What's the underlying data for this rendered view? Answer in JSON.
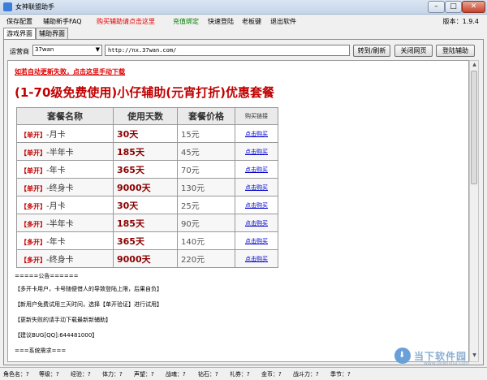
{
  "window": {
    "title": "女神联盟助手"
  },
  "menu": {
    "items": [
      {
        "label": "保存配置"
      },
      {
        "label": "辅助新手FAQ"
      },
      {
        "label": "购买辅助请点击这里"
      },
      {
        "label": "充值绑定"
      },
      {
        "label": "快速登陆"
      },
      {
        "label": "老板键"
      },
      {
        "label": "退出软件"
      }
    ],
    "version": "版本：1.9.4"
  },
  "tabs": [
    {
      "label": "游戏界面"
    },
    {
      "label": "辅助界面"
    }
  ],
  "toolbar": {
    "operator_label": "运营商",
    "operator_value": "37wan",
    "url": "http://nx.37wan.com/",
    "go_label": "转到/刷新",
    "close_label": "关闭网页",
    "login_label": "登陆辅助"
  },
  "content": {
    "notice_link": "如若自动更新失败，点击这里手动下载",
    "heading": "(1-70级免费使用)小仔辅助(元宵打折)优惠套餐",
    "table": {
      "headers": [
        "套餐名称",
        "使用天数",
        "套餐价格",
        "购买链接"
      ],
      "rows": [
        {
          "tag": "【单开】",
          "name": "-月卡",
          "days": "30天",
          "price": "15元",
          "link": "点击购买"
        },
        {
          "tag": "【单开】",
          "name": "-半年卡",
          "days": "185天",
          "price": "45元",
          "link": "点击购买"
        },
        {
          "tag": "【单开】",
          "name": "-年卡",
          "days": "365天",
          "price": "70元",
          "link": "点击购买"
        },
        {
          "tag": "【单开】",
          "name": "-终身卡",
          "days": "9000天",
          "price": "130元",
          "link": "点击购买"
        },
        {
          "tag": "【多开】",
          "name": "-月卡",
          "days": "30天",
          "price": "25元",
          "link": "点击购买"
        },
        {
          "tag": "【多开】",
          "name": "-半年卡",
          "days": "185天",
          "price": "90元",
          "link": "点击购买"
        },
        {
          "tag": "【多开】",
          "name": "-年卡",
          "days": "365天",
          "price": "140元",
          "link": "点击购买"
        },
        {
          "tag": "【多开】",
          "name": "-终身卡",
          "days": "9000天",
          "price": "220元",
          "link": "点击购买"
        }
      ]
    },
    "notes": [
      "=====公告======",
      "【多开卡用户，卡号随便借人的导致登陆上限，后果自负】",
      "【新用户免费试用三天时间，选择【单开验证】进行试用】",
      "【更新失败的请手动下载最新新辅助】",
      "【建议BUG[QQ]:644481000】",
      "===系统需求==="
    ]
  },
  "watermark": {
    "text": "当下软件园",
    "sub": "www.downxia.com"
  },
  "status": [
    "角色名：?",
    "等级：?",
    "经验：?",
    "体力：?",
    "声望：?",
    "战魂：?",
    "钻石：?",
    "礼券：?",
    "金币：?",
    "战斗力：?",
    "季节：?"
  ]
}
